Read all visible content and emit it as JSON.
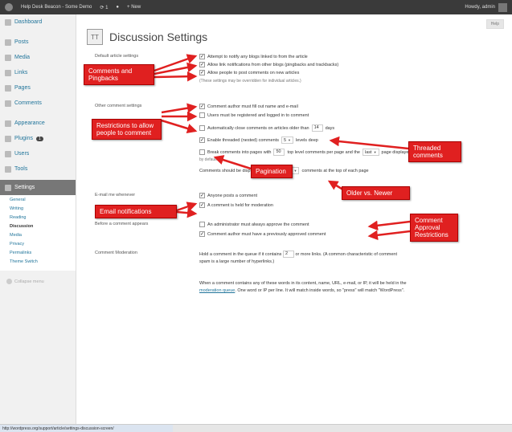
{
  "adminbar": {
    "site_name": "Help Desk Beacon - Some Demo",
    "updates": "1",
    "new_label": "+ New",
    "howdy": "Howdy, admin"
  },
  "sidebar": {
    "items": [
      {
        "label": "Dashboard"
      },
      {
        "label": "Posts"
      },
      {
        "label": "Media"
      },
      {
        "label": "Links"
      },
      {
        "label": "Pages"
      },
      {
        "label": "Comments"
      },
      {
        "label": "Appearance"
      },
      {
        "label": "Plugins",
        "badge": "1"
      },
      {
        "label": "Users"
      },
      {
        "label": "Tools"
      },
      {
        "label": "Settings"
      }
    ],
    "settings_submenu": [
      "General",
      "Writing",
      "Reading",
      "Discussion",
      "Media",
      "Privacy",
      "Permalinks",
      "Theme Switch"
    ],
    "collapse_label": "Collapse menu"
  },
  "main": {
    "help_label": "Help",
    "title": "Discussion Settings",
    "default_article": {
      "label": "Default article settings",
      "options": [
        {
          "checked": true,
          "text": "Attempt to notify any blogs linked to from the article"
        },
        {
          "checked": true,
          "text": "Allow link notifications from other blogs (pingbacks and trackbacks)"
        },
        {
          "checked": true,
          "text": "Allow people to post comments on new articles"
        }
      ],
      "note": "(These settings may be overridden for individual articles.)"
    },
    "other_comment": {
      "label": "Other comment settings",
      "opt1": "Comment author must fill out name and e-mail",
      "opt2": "Users must be registered and logged in to comment",
      "opt3_pre": "Automatically close comments on articles older than",
      "opt3_val": "14",
      "opt3_post": "days",
      "opt4_pre": "Enable threaded (nested) comments",
      "opt4_val": "5",
      "opt4_post": "levels deep",
      "opt5_pre": "Break comments into pages with",
      "opt5_val": "50",
      "opt5_mid": "top level comments per page and the",
      "opt5_sel": "last",
      "opt5_post": "page displayed",
      "opt5_line2": "by default",
      "order_pre": "Comments should be displayed with the",
      "order_sel": "older",
      "order_post": "comments at the top of each page"
    },
    "email_me": {
      "label": "E-mail me whenever",
      "options": [
        {
          "checked": true,
          "text": "Anyone posts a comment"
        },
        {
          "checked": true,
          "text": "A comment is held for moderation"
        }
      ]
    },
    "before_appears": {
      "label": "Before a comment appears",
      "options": [
        {
          "checked": false,
          "text": "An administrator must always approve the comment"
        },
        {
          "checked": true,
          "text": "Comment author must have a previously approved comment"
        }
      ]
    },
    "moderation": {
      "label": "Comment Moderation",
      "line1_pre": "Hold a comment in the queue if it contains",
      "line1_val": "2",
      "line1_post": "or more links. (A common characteristic of comment",
      "line2": "spam is a large number of hyperlinks.)",
      "line3": "When a comment contains any of these words in its content, name, URL, e-mail, or IP, it will be held in the",
      "line4_link": "moderation queue",
      "line4_post": ". One word or IP per line. It will match inside words, so \"press\" will match \"WordPress\"."
    }
  },
  "callouts": {
    "comments_pingbacks": "Comments and Pingbacks",
    "restrictions": "Restrictions to allow people to comment",
    "threaded": "Threaded comments",
    "pagination": "Pagination",
    "older_newer": "Older vs. Newer",
    "email_notifications": "Email notifications",
    "approval": "Comment Approval Restrictions"
  },
  "statusbar": {
    "url": "http://wordpress.org/support/article/settings-discussion-screen/"
  },
  "colors": {
    "callout": "#e02020",
    "link": "#21759b",
    "adminbar": "#3a3a3a"
  }
}
